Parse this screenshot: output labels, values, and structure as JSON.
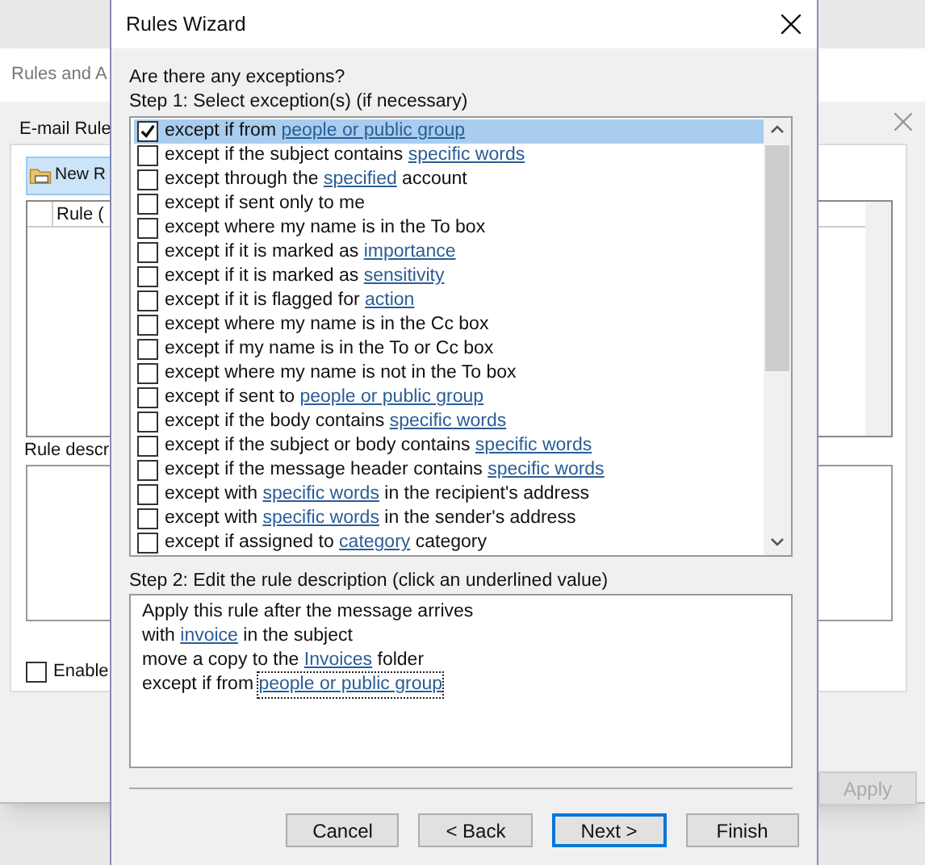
{
  "background_window": {
    "title": "Rules and A",
    "tab": "E-mail Rule",
    "new_button": "New R",
    "column_header": "Rule (",
    "description_label": "Rule descr",
    "enable_checkbox": {
      "label": "Enable",
      "checked": false
    },
    "apply_button": {
      "label": "Apply",
      "disabled": true
    }
  },
  "window": {
    "title": "Rules Wizard"
  },
  "question": "Are there any exceptions?",
  "step1_label": "Step 1: Select exception(s) (if necessary)",
  "exceptions": [
    {
      "checked": true,
      "selected": true,
      "segments": [
        {
          "kind": "plain",
          "text": "except if from "
        },
        {
          "kind": "link",
          "text": "people or public group"
        }
      ]
    },
    {
      "checked": false,
      "selected": false,
      "segments": [
        {
          "kind": "plain",
          "text": "except if the subject contains "
        },
        {
          "kind": "link",
          "text": "specific words"
        }
      ]
    },
    {
      "checked": false,
      "selected": false,
      "segments": [
        {
          "kind": "plain",
          "text": "except through the "
        },
        {
          "kind": "link",
          "text": "specified"
        },
        {
          "kind": "plain",
          "text": " account"
        }
      ]
    },
    {
      "checked": false,
      "selected": false,
      "segments": [
        {
          "kind": "plain",
          "text": "except if sent only to me"
        }
      ]
    },
    {
      "checked": false,
      "selected": false,
      "segments": [
        {
          "kind": "plain",
          "text": "except where my name is in the To box"
        }
      ]
    },
    {
      "checked": false,
      "selected": false,
      "segments": [
        {
          "kind": "plain",
          "text": "except if it is marked as "
        },
        {
          "kind": "link",
          "text": "importance"
        }
      ]
    },
    {
      "checked": false,
      "selected": false,
      "segments": [
        {
          "kind": "plain",
          "text": "except if it is marked as "
        },
        {
          "kind": "link",
          "text": "sensitivity"
        }
      ]
    },
    {
      "checked": false,
      "selected": false,
      "segments": [
        {
          "kind": "plain",
          "text": "except if it is flagged for "
        },
        {
          "kind": "link",
          "text": "action"
        }
      ]
    },
    {
      "checked": false,
      "selected": false,
      "segments": [
        {
          "kind": "plain",
          "text": "except where my name is in the Cc box"
        }
      ]
    },
    {
      "checked": false,
      "selected": false,
      "segments": [
        {
          "kind": "plain",
          "text": "except if my name is in the To or Cc box"
        }
      ]
    },
    {
      "checked": false,
      "selected": false,
      "segments": [
        {
          "kind": "plain",
          "text": "except where my name is not in the To box"
        }
      ]
    },
    {
      "checked": false,
      "selected": false,
      "segments": [
        {
          "kind": "plain",
          "text": "except if sent to "
        },
        {
          "kind": "link",
          "text": "people or public group"
        }
      ]
    },
    {
      "checked": false,
      "selected": false,
      "segments": [
        {
          "kind": "plain",
          "text": "except if the body contains "
        },
        {
          "kind": "link",
          "text": "specific words"
        }
      ]
    },
    {
      "checked": false,
      "selected": false,
      "segments": [
        {
          "kind": "plain",
          "text": "except if the subject or body contains "
        },
        {
          "kind": "link",
          "text": "specific words"
        }
      ]
    },
    {
      "checked": false,
      "selected": false,
      "segments": [
        {
          "kind": "plain",
          "text": "except if the message header contains "
        },
        {
          "kind": "link",
          "text": "specific words"
        }
      ]
    },
    {
      "checked": false,
      "selected": false,
      "segments": [
        {
          "kind": "plain",
          "text": "except with "
        },
        {
          "kind": "link",
          "text": "specific words"
        },
        {
          "kind": "plain",
          "text": " in the recipient's address"
        }
      ]
    },
    {
      "checked": false,
      "selected": false,
      "segments": [
        {
          "kind": "plain",
          "text": "except with "
        },
        {
          "kind": "link",
          "text": "specific words"
        },
        {
          "kind": "plain",
          "text": " in the sender's address"
        }
      ]
    },
    {
      "checked": false,
      "selected": false,
      "segments": [
        {
          "kind": "plain",
          "text": "except if assigned to "
        },
        {
          "kind": "link",
          "text": "category"
        },
        {
          "kind": "plain",
          "text": " category"
        }
      ]
    }
  ],
  "step2_label": "Step 2: Edit the rule description (click an underlined value)",
  "description": [
    {
      "segments": [
        {
          "kind": "plain",
          "text": "Apply this rule after the message arrives"
        }
      ]
    },
    {
      "segments": [
        {
          "kind": "plain",
          "text": "with "
        },
        {
          "kind": "link",
          "text": "invoice",
          "focused": false
        },
        {
          "kind": "plain",
          "text": " in the subject"
        }
      ]
    },
    {
      "segments": [
        {
          "kind": "plain",
          "text": "move a copy to the "
        },
        {
          "kind": "link",
          "text": "Invoices",
          "focused": false
        },
        {
          "kind": "plain",
          "text": " folder"
        }
      ]
    },
    {
      "segments": [
        {
          "kind": "plain",
          "text": "except if from "
        },
        {
          "kind": "link",
          "text": "people or public group",
          "focused": true
        }
      ]
    }
  ],
  "buttons": [
    {
      "label": "Cancel",
      "default": false
    },
    {
      "label": "< Back",
      "default": false
    },
    {
      "label": "Next >",
      "default": true
    },
    {
      "label": "Finish",
      "default": false
    }
  ]
}
